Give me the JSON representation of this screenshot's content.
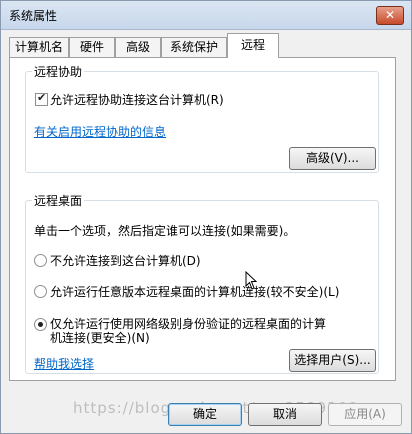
{
  "window": {
    "title": "系统属性",
    "close_label": "✕"
  },
  "tabs": [
    {
      "label": "计算机名",
      "active": false
    },
    {
      "label": "硬件",
      "active": false
    },
    {
      "label": "高级",
      "active": false
    },
    {
      "label": "系统保护",
      "active": false
    },
    {
      "label": "远程",
      "active": true
    }
  ],
  "remote_assistance": {
    "group_label": "远程协助",
    "allow_checkbox_label": "允许远程协助连接这台计算机(R)",
    "allow_checked": true,
    "info_link": "有关启用远程协助的信息",
    "advanced_button": "高级(V)..."
  },
  "remote_desktop": {
    "group_label": "远程桌面",
    "instruction": "单击一个选项，然后指定谁可以连接(如果需要)。",
    "options": [
      {
        "label": "不允许连接到这台计算机(D)",
        "selected": false
      },
      {
        "label": "允许运行任意版本远程桌面的计算机连接(较不安全)(L)",
        "selected": false
      },
      {
        "label_line1": "仅允许运行使用网络级别身份验证的远程桌面的计算",
        "label_line2": "机连接(更安全)(N)",
        "selected": true
      }
    ],
    "help_link": "帮助我选择",
    "select_users_button": "选择用户(S)..."
  },
  "footer": {
    "ok_button": "确定",
    "cancel_button": "取消",
    "apply_button": "应用(A)"
  },
  "watermark": "https://blog.csdn.net/qq_3589309"
}
